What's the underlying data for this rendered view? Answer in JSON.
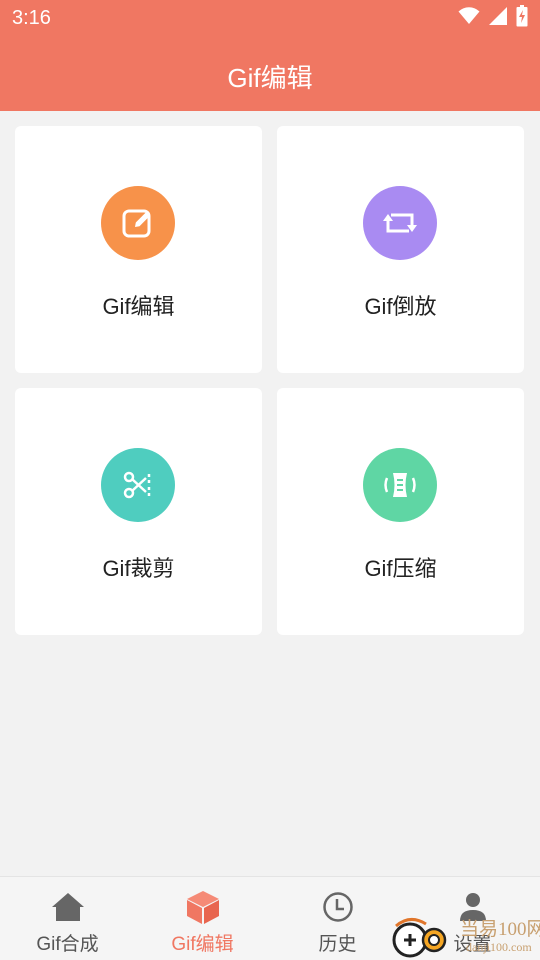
{
  "status_bar": {
    "time": "3:16",
    "icons": [
      "wifi-icon",
      "signal-icon",
      "battery-icon"
    ]
  },
  "header": {
    "title": "Gif编辑",
    "background_color": "#f07762"
  },
  "cards": [
    {
      "label": "Gif编辑",
      "icon": "edit-icon",
      "color": "#f7924a"
    },
    {
      "label": "Gif倒放",
      "icon": "reverse-icon",
      "color": "#a98bf2"
    },
    {
      "label": "Gif裁剪",
      "icon": "scissors-icon",
      "color": "#4fcdbf"
    },
    {
      "label": "Gif压缩",
      "icon": "compress-icon",
      "color": "#5fd6a4"
    }
  ],
  "bottom_nav": {
    "items": [
      {
        "label": "Gif合成",
        "icon": "home-icon",
        "active": false
      },
      {
        "label": "Gif编辑",
        "icon": "cube-icon",
        "active": true
      },
      {
        "label": "历史",
        "icon": "clock-icon",
        "active": false
      },
      {
        "label": "设置",
        "icon": "person-icon",
        "active": false
      }
    ],
    "active_color": "#f07762"
  },
  "watermark": {
    "text": "当易100网",
    "url": "danji100.com"
  }
}
